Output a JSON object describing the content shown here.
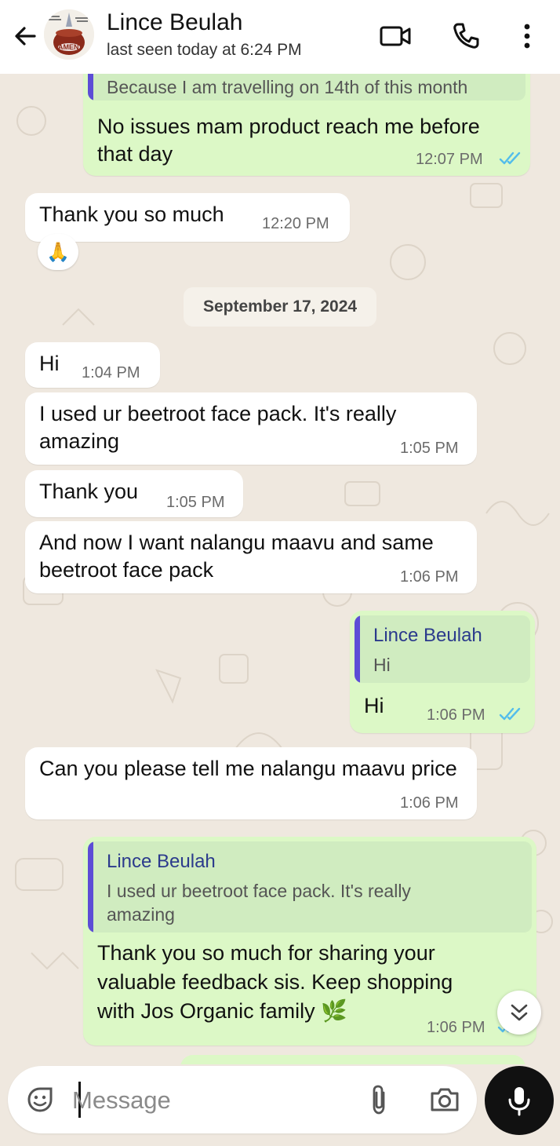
{
  "header": {
    "contact_name": "Lince Beulah",
    "status": "last seen today at 6:24 PM",
    "avatar_caption": "AMEN"
  },
  "chat": {
    "date_chip": "September 17, 2024",
    "messages": [
      {
        "dir": "out",
        "quote_text": "Because I am travelling on 14th of this month",
        "text": "No issues mam product reach me before that day",
        "time": "12:07 PM",
        "read": true
      },
      {
        "dir": "in",
        "text": "Thank you so much",
        "time": "12:20 PM",
        "reaction": "🙏"
      },
      {
        "dir": "in",
        "text": "Hi",
        "time": "1:04 PM"
      },
      {
        "dir": "in",
        "text": "I used ur beetroot face pack. It's really amazing",
        "time": "1:05 PM"
      },
      {
        "dir": "in",
        "text": "Thank you",
        "time": "1:05 PM"
      },
      {
        "dir": "in",
        "text": "And now I want nalangu maavu and same beetroot face pack",
        "time": "1:06 PM"
      },
      {
        "dir": "out",
        "quote_name": "Lince Beulah",
        "quote_text": "Hi",
        "text": "Hi",
        "time": "1:06 PM",
        "read": true
      },
      {
        "dir": "in",
        "text": "Can you please tell me nalangu maavu price",
        "time": "1:06 PM"
      },
      {
        "dir": "out",
        "quote_name": "Lince Beulah",
        "quote_text": "I used ur beetroot face pack. It's really amazing",
        "text": "Thank you so much for sharing your valuable feedback sis. Keep shopping with Jos Organic family 🌿",
        "time": "1:06 PM",
        "read": true
      }
    ]
  },
  "composer": {
    "placeholder": "Message"
  },
  "colors": {
    "outgoing_bubble": "#dcf8c6",
    "incoming_bubble": "#ffffff",
    "read_ticks": "#53bdeb",
    "wallpaper": "#efe8df",
    "quote_bar": "#5c4dd6"
  },
  "icons": {
    "back": "back-arrow-icon",
    "video": "video-call-icon",
    "call": "phone-icon",
    "menu": "more-vert-icon",
    "sticker": "sticker-icon",
    "attach": "paperclip-icon",
    "camera": "camera-icon",
    "mic": "mic-icon",
    "scroll": "double-chevron-down-icon"
  }
}
